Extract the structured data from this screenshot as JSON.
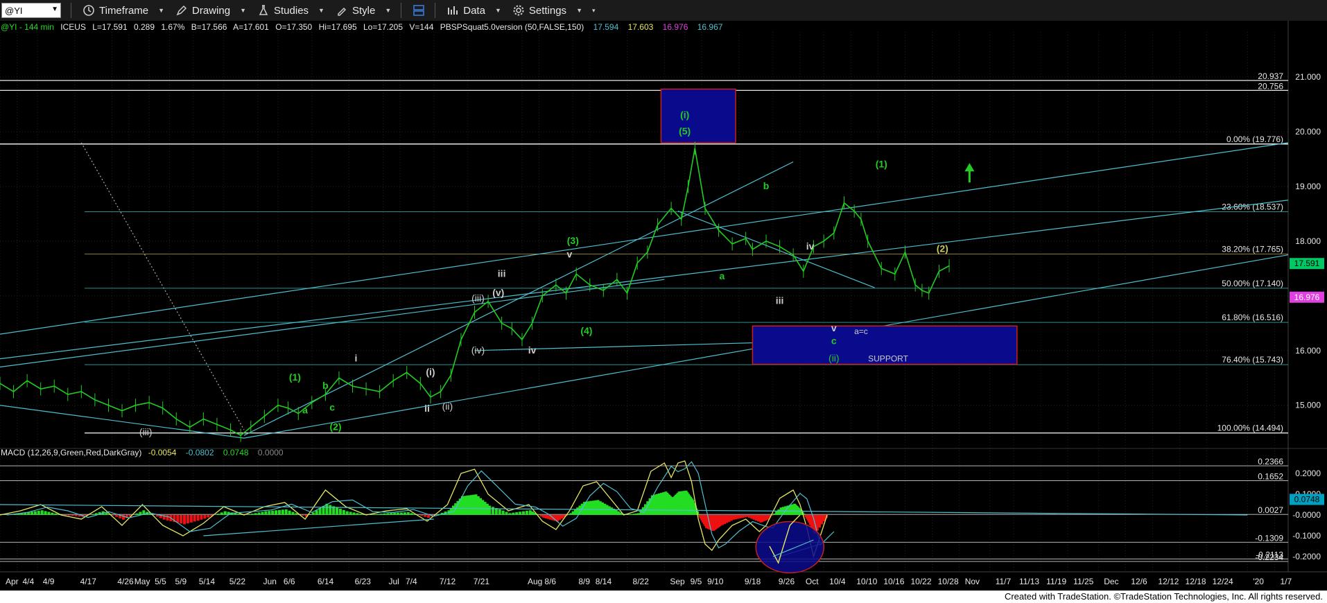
{
  "toolbar": {
    "symbol": "@YI",
    "timeframe_label": "Timeframe",
    "drawing_label": "Drawing",
    "studies_label": "Studies",
    "style_label": "Style",
    "data_label": "Data",
    "settings_label": "Settings"
  },
  "colors": {
    "background": "#000000",
    "price": "#22cc22",
    "trendline": "#4fbfd0",
    "fib": "#2a8f8f",
    "box": "#0a0a8c",
    "box_border": "#c8201a",
    "last_price_badge": "#00c864",
    "magenta_badge": "#e040e0",
    "macd_pos": "#22dd22",
    "macd_neg": "#ee1111"
  },
  "header": {
    "symbol_info": "@YI - 144 min",
    "exchange": "ICEUS",
    "last": "L=17.591",
    "change": "0.289",
    "change_pct": "1.67%",
    "bid": "B=17.566",
    "ask": "A=17.601",
    "open": "O=17.350",
    "high": "Hi=17.695",
    "low": "Lo=17.205",
    "volume": "V=144",
    "study": "PBSPSquat5.0version (50,FALSE,150)",
    "study_v1": "17.594",
    "study_v2": "17.603",
    "study_v3": "16.976",
    "study_v4": "16.967"
  },
  "macd_header": {
    "name": "MACD (12,26,9,Green,Red,DarkGray)",
    "v1": "-0.0054",
    "v2": "-0.0802",
    "v3": "0.0748",
    "v4": "0.0000"
  },
  "chart_data": {
    "type": "line",
    "price_axis": {
      "ylim": [
        14.3,
        21.8
      ],
      "ticks": [
        "21.000",
        "20.000",
        "19.000",
        "18.000",
        "17.000",
        "16.000",
        "15.000"
      ],
      "tick_values": [
        21,
        20,
        19,
        18,
        17,
        16,
        15
      ],
      "last_price": "17.591",
      "last_price_value": 17.591,
      "magenta_price": "16.976",
      "magenta_price_value": 16.976
    },
    "macd_axis": {
      "ylim": [
        -0.24,
        0.27
      ],
      "ticks": [
        "0.2000",
        "0.1000",
        "-0.0000",
        "-0.1000",
        "-0.2000"
      ],
      "tick_values": [
        0.2,
        0.1,
        0,
        -0.1,
        -0.2
      ],
      "level_labels": [
        "0.2366",
        "0.1652",
        "0.0027",
        "-0.1309",
        "-0.2113",
        "-0.2234"
      ],
      "level_values": [
        0.2366,
        0.1652,
        0.0027,
        -0.1309,
        -0.2113,
        -0.2234
      ],
      "last_value": "0.0748",
      "last_value_num": 0.0748
    },
    "x_axis": {
      "labels": [
        "Apr",
        "4/4",
        "4/9",
        "4/17",
        "4/26",
        "May",
        "5/5",
        "5/9",
        "5/14",
        "5/22",
        "Jun",
        "6/6",
        "6/14",
        "6/23",
        "Jul",
        "7/4",
        "7/12",
        "7/21",
        "Aug",
        "8/6",
        "8/9",
        "8/14",
        "8/22",
        "Sep",
        "9/5",
        "9/10",
        "9/18",
        "9/26",
        "Oct",
        "10/4",
        "10/10",
        "10/16",
        "10/22",
        "10/28",
        "Nov",
        "11/7",
        "11/13",
        "11/19",
        "11/25",
        "Dec",
        "12/6",
        "12/12",
        "12/18",
        "12/24",
        "'20",
        "1/7"
      ],
      "positions": [
        0,
        2.5,
        5.5,
        11,
        16.5,
        19,
        22,
        25,
        28.5,
        33,
        38,
        41,
        46,
        51.5,
        56.5,
        59,
        64,
        69,
        77,
        79.5,
        84.5,
        87,
        92.5,
        98,
        101,
        103.5,
        109,
        114,
        118,
        121.5,
        125.5,
        129.5,
        133.5,
        137.5,
        141.5,
        146,
        149.5,
        153.5,
        157.5,
        162,
        166,
        170,
        174,
        178,
        184,
        188
      ]
    },
    "price_series": {
      "name": "@YI",
      "x": [
        0,
        2,
        4,
        6,
        8,
        10,
        12,
        14,
        16,
        18,
        20,
        22,
        24,
        26,
        28,
        30,
        32,
        34,
        35.5,
        37,
        39,
        41,
        42.5,
        44,
        46,
        48,
        50,
        52,
        54,
        56,
        58,
        60,
        62,
        63.5,
        65,
        66.5,
        68,
        70,
        72,
        74,
        75.5,
        77,
        78.5,
        80,
        82,
        83.5,
        85,
        87,
        89,
        91,
        92.5,
        94,
        95.5,
        97,
        99,
        100.5,
        101.5,
        102.5,
        104,
        106,
        108,
        110,
        111,
        113,
        115,
        117,
        118.5,
        120,
        121.5,
        123,
        124.5,
        126,
        127,
        128,
        130,
        132,
        133.5,
        135,
        136,
        137,
        138.5,
        140
      ],
      "values": [
        15.4,
        15.25,
        15.45,
        15.3,
        15.35,
        15.2,
        15.25,
        15.1,
        15.0,
        14.9,
        15.0,
        15.05,
        14.95,
        14.75,
        14.6,
        14.75,
        14.65,
        14.55,
        14.45,
        14.6,
        14.8,
        15.0,
        14.95,
        14.85,
        15.05,
        15.2,
        15.5,
        15.35,
        15.3,
        15.25,
        15.45,
        15.6,
        15.4,
        15.15,
        15.25,
        15.55,
        16.2,
        16.7,
        16.9,
        16.5,
        16.4,
        16.2,
        16.5,
        17.0,
        17.2,
        17.05,
        17.4,
        17.2,
        17.1,
        17.3,
        17.05,
        17.6,
        17.8,
        18.3,
        18.6,
        18.4,
        19.0,
        19.7,
        18.6,
        18.2,
        17.95,
        18.05,
        17.85,
        18.0,
        17.9,
        17.75,
        17.45,
        17.9,
        18.0,
        18.15,
        18.7,
        18.55,
        18.4,
        18.0,
        17.5,
        17.4,
        17.8,
        17.2,
        17.1,
        17.05,
        17.45,
        17.55
      ]
    },
    "macd_series": {
      "name": "MACD",
      "x": [
        0,
        3,
        6,
        9,
        12,
        15,
        18,
        21,
        24,
        27,
        30,
        33,
        36,
        39,
        42,
        45,
        48,
        51,
        54,
        57,
        60,
        63,
        66,
        68,
        70,
        72,
        75,
        78,
        80,
        82,
        84,
        86,
        88,
        90,
        92,
        94,
        96,
        98,
        99,
        100,
        101,
        102,
        103,
        104,
        105,
        106,
        108,
        110,
        112,
        113,
        115,
        117,
        118,
        119,
        120,
        122
      ],
      "values": [
        0.0,
        0.02,
        0.05,
        0.0,
        -0.02,
        0.04,
        -0.05,
        0.05,
        -0.05,
        -0.1,
        -0.04,
        0.04,
        0.0,
        0.04,
        0.06,
        -0.02,
        0.12,
        0.04,
        0.0,
        0.02,
        0.03,
        -0.03,
        0.05,
        0.2,
        0.22,
        0.1,
        0.02,
        0.05,
        -0.03,
        -0.07,
        0.02,
        0.14,
        0.16,
        0.08,
        0.0,
        0.02,
        0.21,
        0.25,
        0.18,
        0.25,
        0.26,
        0.16,
        -0.02,
        -0.14,
        -0.17,
        -0.12,
        -0.05,
        -0.02,
        -0.08,
        -0.05,
        0.08,
        0.12,
        0.05,
        -0.06,
        -0.2,
        0.0
      ]
    },
    "fib_levels": [
      {
        "label": "0.00% (19.776)",
        "value": 19.776
      },
      {
        "label": "23.60% (18.537)",
        "value": 18.537
      },
      {
        "label": "38.20% (17.765)",
        "value": 17.765
      },
      {
        "label": "50.00% (17.140)",
        "value": 17.14
      },
      {
        "label": "61.80% (16.516)",
        "value": 16.516
      },
      {
        "label": "76.40% (15.743)",
        "value": 15.743
      },
      {
        "label": "100.00% (14.494)",
        "value": 14.494
      }
    ],
    "resistance_levels": [
      {
        "label": "20.937",
        "value": 20.937
      },
      {
        "label": "20.756",
        "value": 20.756
      }
    ],
    "wave_labels": [
      {
        "text": "(i)",
        "x": 101,
        "y": 20.25,
        "color": "#22cc22"
      },
      {
        "text": "(5)",
        "x": 101,
        "y": 19.95,
        "color": "#22cc22"
      },
      {
        "text": "(1)",
        "x": 130,
        "y": 19.35,
        "color": "#22cc22"
      },
      {
        "text": "b",
        "x": 113,
        "y": 18.95,
        "color": "#22cc22"
      },
      {
        "text": "(2)",
        "x": 139,
        "y": 17.8,
        "color": "#c8c860"
      },
      {
        "text": "iv",
        "x": 119.5,
        "y": 17.85,
        "color": "#cccccc"
      },
      {
        "text": "v",
        "x": 84,
        "y": 17.7,
        "color": "#cccccc"
      },
      {
        "text": "(3)",
        "x": 84.5,
        "y": 17.95,
        "color": "#22cc22"
      },
      {
        "text": "a",
        "x": 106.5,
        "y": 17.3,
        "color": "#22cc22"
      },
      {
        "text": "iii",
        "x": 74,
        "y": 17.35,
        "color": "#cccccc"
      },
      {
        "text": "iii",
        "x": 115,
        "y": 16.85,
        "color": "#cccccc"
      },
      {
        "text": "(iii)",
        "x": 70.5,
        "y": 16.9,
        "color": "#cccccc"
      },
      {
        "text": "(v)",
        "x": 73.5,
        "y": 17.0,
        "color": "#cccccc"
      },
      {
        "text": "v",
        "x": 123,
        "y": 16.35,
        "color": "#cccccc"
      },
      {
        "text": "a=c",
        "x": 127,
        "y": 16.3,
        "color": "#cccccc"
      },
      {
        "text": "c",
        "x": 123,
        "y": 16.12,
        "color": "#22cc22"
      },
      {
        "text": "(4)",
        "x": 86.5,
        "y": 16.3,
        "color": "#22cc22"
      },
      {
        "text": "iv",
        "x": 78.5,
        "y": 15.95,
        "color": "#cccccc"
      },
      {
        "text": "(iv)",
        "x": 70.5,
        "y": 15.95,
        "color": "#cccccc"
      },
      {
        "text": "(ii)",
        "x": 123,
        "y": 15.8,
        "color": "#22cc22"
      },
      {
        "text": "SUPPORT",
        "x": 131,
        "y": 15.8,
        "color": "#cccccc"
      },
      {
        "text": "i",
        "x": 52.5,
        "y": 15.8,
        "color": "#cccccc"
      },
      {
        "text": "(1)",
        "x": 43.5,
        "y": 15.45,
        "color": "#22cc22"
      },
      {
        "text": "(i)",
        "x": 63.5,
        "y": 15.55,
        "color": "#cccccc"
      },
      {
        "text": "b",
        "x": 48,
        "y": 15.3,
        "color": "#22cc22"
      },
      {
        "text": "a",
        "x": 45,
        "y": 14.85,
        "color": "#22cc22"
      },
      {
        "text": "c",
        "x": 49,
        "y": 14.9,
        "color": "#22cc22"
      },
      {
        "text": "ii",
        "x": 63,
        "y": 14.88,
        "color": "#cccccc"
      },
      {
        "text": "(ii)",
        "x": 66,
        "y": 14.92,
        "color": "#cccccc"
      },
      {
        "text": "(2)",
        "x": 49.5,
        "y": 14.55,
        "color": "#22cc22"
      },
      {
        "text": "(iii)",
        "x": 21.5,
        "y": 14.45,
        "color": "#cccccc"
      }
    ],
    "boxes": [
      {
        "x1": 97.5,
        "x2": 108.5,
        "y1": 19.8,
        "y2": 20.78
      },
      {
        "x1": 111,
        "x2": 150,
        "y1": 15.75,
        "y2": 16.45
      }
    ]
  },
  "footer": "Created with TradeStation. ©TradeStation Technologies, Inc. All rights reserved."
}
